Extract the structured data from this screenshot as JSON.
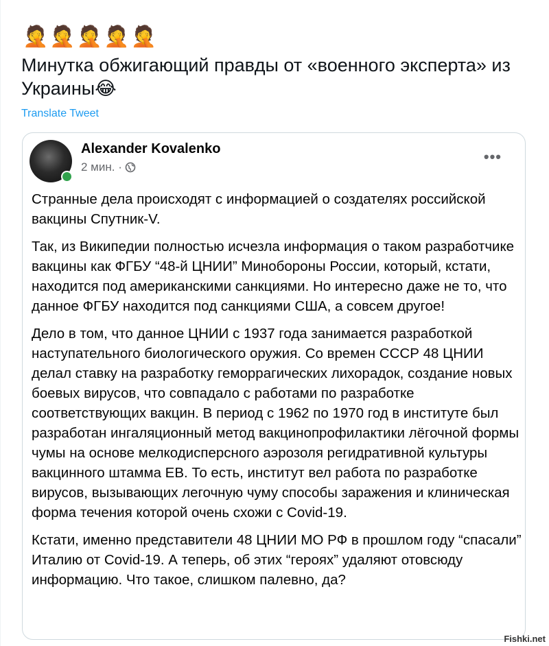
{
  "tweet": {
    "emojis": [
      "🤦",
      "🤦",
      "🤦",
      "🤦",
      "🤦"
    ],
    "text": "Минутка обжигающий правды от «военного эксперта» из Украины😂",
    "translate_label": "Translate Tweet"
  },
  "embedded_post": {
    "author": "Alexander Kovalenko",
    "time": "2 мин. ·",
    "privacy_icon": "globe-icon",
    "more_icon": "more-options-icon",
    "paragraphs": [
      "Странные дела происходят с информацией о создателях российской вакцины Спутник-V.",
      "Так, из Википедии полностью исчезла информация о таком разработчике вакцины как ФГБУ “48-й ЦНИИ” Минобороны России, который, кстати, находится под американскими санкциями. Но интересно даже не то, что данное ФГБУ находится под санкциями США, а совсем другое!",
      "Дело в том, что данное ЦНИИ с 1937 года занимается разработкой наступательного биологического оружия. Со времен СССР 48 ЦНИИ делал ставку на разработку геморрагических лихорадок, создание новых боевых вирусов, что совпадало с работами по разработке соответствующих вакцин. В период с 1962 по 1970 год в институте был разработан ингаляционный метод вакцинопрофилактики лёгочной формы чумы на основе мелкодисперсного аэрозоля регидративной культуры вакцинного штамма ЕВ. То есть, институт вел работа по разработке вирусов, вызывающих легочную чуму способы заражения и клиническая форма течения которой очень схожи с Covid-19.",
      "Кстати, именно представители 48 ЦНИИ МО РФ в прошлом году “спасали” Италию от Covid-19. А теперь, об этих “героях” удаляют отовсюду информацию. Что такое, слишком палевно, да?"
    ]
  },
  "watermark": "Fishki.net",
  "colors": {
    "link": "#1d9bf0",
    "online_dot": "#31a24c",
    "card_border": "#cfd9de"
  }
}
